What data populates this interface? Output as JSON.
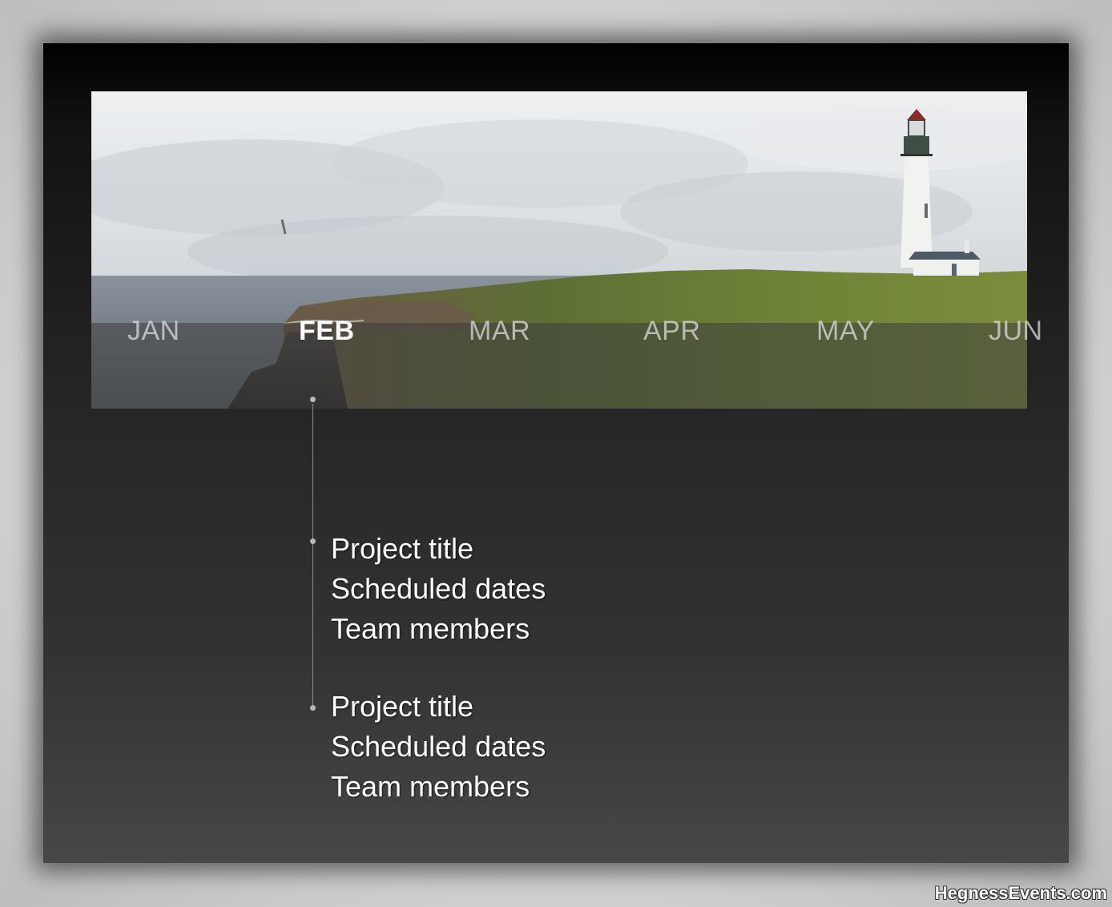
{
  "timeline": {
    "months": [
      "JAN",
      "FEB",
      "MAR",
      "APR",
      "MAY",
      "JUN"
    ],
    "active_month": "FEB"
  },
  "projects": [
    {
      "title": "Project title",
      "dates": "Scheduled dates",
      "members": "Team members"
    },
    {
      "title": "Project title",
      "dates": "Scheduled dates",
      "members": "Team members"
    }
  ],
  "watermark": "HegnessEvents.com",
  "banner_image": "lighthouse-on-coastal-cliff",
  "colors": {
    "background": "#c8c8c8",
    "slide_top": "#000000",
    "slide_bottom": "#474747",
    "text": "#ffffff",
    "month_inactive": "#e1e1e1"
  }
}
